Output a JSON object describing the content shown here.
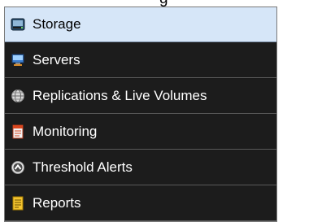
{
  "header": {
    "partial_text": "g"
  },
  "nav": {
    "selected_index": 0,
    "items": [
      {
        "label": "Storage",
        "icon": "storage-icon"
      },
      {
        "label": "Servers",
        "icon": "servers-icon"
      },
      {
        "label": "Replications & Live Volumes",
        "icon": "replications-icon"
      },
      {
        "label": "Monitoring",
        "icon": "monitoring-icon"
      },
      {
        "label": "Threshold Alerts",
        "icon": "threshold-alerts-icon"
      },
      {
        "label": "Reports",
        "icon": "reports-icon"
      }
    ]
  },
  "colors": {
    "selected_bg": "#d6e6f8",
    "item_bg": "#1c1c1c",
    "item_text": "#ffffff",
    "selected_text": "#000000"
  }
}
